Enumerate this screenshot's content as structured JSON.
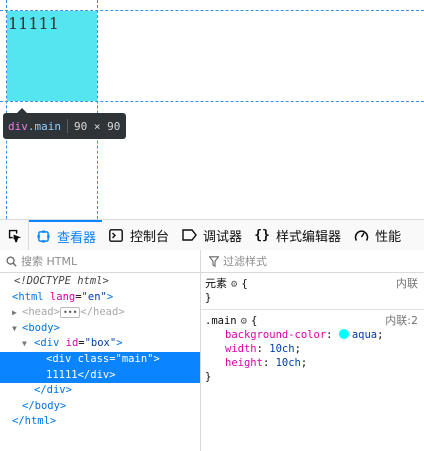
{
  "page": {
    "content_text": "11111",
    "highlight_color": "#55e5f0",
    "infobar": {
      "tag": "div",
      "class": ".main",
      "dims": "90 × 90"
    }
  },
  "toolbar": {
    "tabs": [
      {
        "label": "查看器",
        "icon": "inspector-icon",
        "active": true
      },
      {
        "label": "控制台",
        "icon": "console-icon",
        "active": false
      },
      {
        "label": "调试器",
        "icon": "debugger-icon",
        "active": false
      },
      {
        "label": "样式编辑器",
        "icon": "style-editor-icon",
        "active": false
      },
      {
        "label": "性能",
        "icon": "performance-icon",
        "active": false
      }
    ],
    "accent": "#0a84ff"
  },
  "markup": {
    "search_placeholder": "搜索 HTML",
    "doctype": "<!DOCTYPE html>",
    "html_open": "<html",
    "html_attr": " lang",
    "html_val": "\"en\"",
    "html_close": ">",
    "head_open": "<head>",
    "head_close": "</head>",
    "body_open": "<body>",
    "div_open": "<div",
    "div_attr": " id",
    "div_val": "\"box\"",
    "div_close": ">",
    "main_open": "<div class=\"main\">",
    "main_text": "11111</div>",
    "div_end": "</div>",
    "body_end": "</body>",
    "html_end": "</html>"
  },
  "rules": {
    "filter_placeholder": "过滤样式",
    "element": {
      "selector": "元素",
      "source": "内联",
      "open": "{",
      "close": "}"
    },
    "main": {
      "selector": ".main",
      "source": "内联:2",
      "open": "{",
      "close": "}",
      "decls": [
        {
          "name": "background-color",
          "value": "aqua"
        },
        {
          "name": "width",
          "value": "10ch"
        },
        {
          "name": "height",
          "value": "10ch"
        }
      ]
    }
  }
}
